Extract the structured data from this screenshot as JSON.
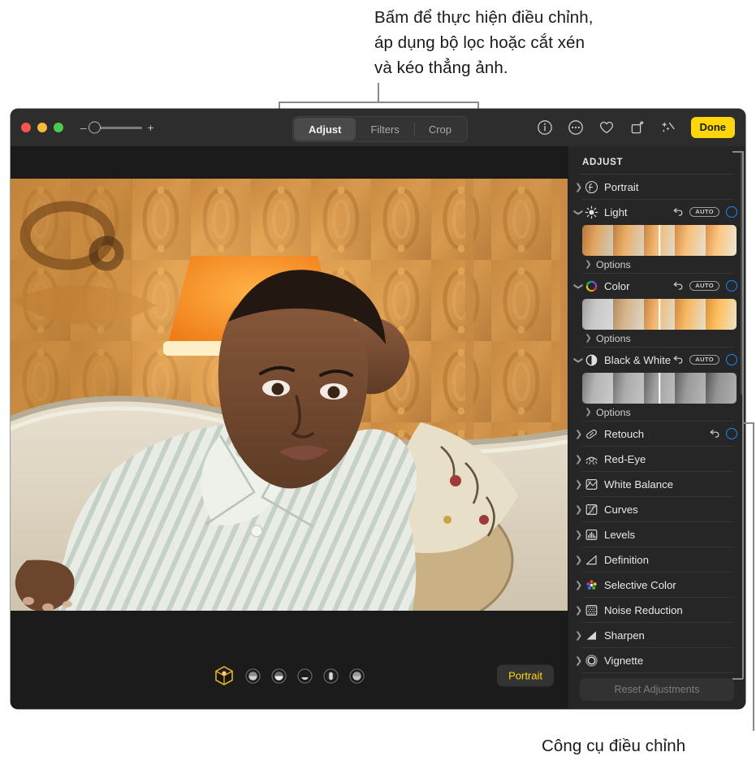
{
  "annotations": {
    "top": "Bấm để thực hiện điều chỉnh,\náp dụng bộ lọc hoặc cắt xén\nvà kéo thẳng ảnh.",
    "bottom": "Công cụ điều chỉnh"
  },
  "window": {
    "traffic_lights": [
      "close",
      "minimize",
      "zoom"
    ],
    "zoom_slider": {
      "minus": "–",
      "plus": "+",
      "value": 0
    },
    "segmented": {
      "options": [
        "Adjust",
        "Filters",
        "Crop"
      ],
      "selected": "Adjust"
    },
    "toolbar_icons": [
      "info-icon",
      "more-options-icon",
      "favorite-heart-icon",
      "rotate-icon",
      "auto-enhance-icon"
    ],
    "done_label": "Done"
  },
  "bottom_bar": {
    "lighting_effects": [
      "natural-light-cube",
      "studio-light",
      "contour-light",
      "stage-light",
      "stage-light-mono",
      "high-key-mono"
    ],
    "selected_index": 0,
    "mode_label": "Portrait"
  },
  "panel": {
    "title": "ADJUST",
    "reset_label": "Reset Adjustments",
    "options_label": "Options",
    "auto_label": "AUTO",
    "sections": [
      {
        "label": "Portrait",
        "icon": "portrait-f-icon",
        "expanded": false,
        "has_auto": false,
        "has_undo": false,
        "has_toggle": false,
        "has_filmstrip": false
      },
      {
        "label": "Light",
        "icon": "light-sun-icon",
        "expanded": true,
        "has_auto": true,
        "has_undo": true,
        "has_toggle": true,
        "has_filmstrip": true
      },
      {
        "label": "Color",
        "icon": "color-wheel-icon",
        "expanded": true,
        "has_auto": true,
        "has_undo": true,
        "has_toggle": true,
        "has_filmstrip": true
      },
      {
        "label": "Black & White",
        "icon": "black-white-circle-icon",
        "expanded": true,
        "has_auto": true,
        "has_undo": true,
        "has_toggle": true,
        "has_filmstrip": true
      },
      {
        "label": "Retouch",
        "icon": "retouch-bandage-icon",
        "expanded": false,
        "has_auto": false,
        "has_undo": true,
        "has_toggle": true,
        "has_filmstrip": false
      },
      {
        "label": "Red-Eye",
        "icon": "red-eye-icon",
        "expanded": false,
        "has_auto": false,
        "has_undo": false,
        "has_toggle": false,
        "has_filmstrip": false
      },
      {
        "label": "White Balance",
        "icon": "white-balance-icon",
        "expanded": false,
        "has_auto": false,
        "has_undo": false,
        "has_toggle": false,
        "has_filmstrip": false
      },
      {
        "label": "Curves",
        "icon": "curves-icon",
        "expanded": false,
        "has_auto": false,
        "has_undo": false,
        "has_toggle": false,
        "has_filmstrip": false
      },
      {
        "label": "Levels",
        "icon": "levels-icon",
        "expanded": false,
        "has_auto": false,
        "has_undo": false,
        "has_toggle": false,
        "has_filmstrip": false
      },
      {
        "label": "Definition",
        "icon": "definition-icon",
        "expanded": false,
        "has_auto": false,
        "has_undo": false,
        "has_toggle": false,
        "has_filmstrip": false
      },
      {
        "label": "Selective Color",
        "icon": "selective-color-icon",
        "expanded": false,
        "has_auto": false,
        "has_undo": false,
        "has_toggle": false,
        "has_filmstrip": false
      },
      {
        "label": "Noise Reduction",
        "icon": "noise-reduction-icon",
        "expanded": false,
        "has_auto": false,
        "has_undo": false,
        "has_toggle": false,
        "has_filmstrip": false
      },
      {
        "label": "Sharpen",
        "icon": "sharpen-icon",
        "expanded": false,
        "has_auto": false,
        "has_undo": false,
        "has_toggle": false,
        "has_filmstrip": false
      },
      {
        "label": "Vignette",
        "icon": "vignette-icon",
        "expanded": false,
        "has_auto": false,
        "has_undo": false,
        "has_toggle": false,
        "has_filmstrip": false
      }
    ]
  },
  "colors": {
    "accent_yellow": "#ffd60a",
    "toggle_blue": "#1b84ff",
    "panel_bg": "#262626",
    "toolbar_bg": "#2d2d2d",
    "window_bg": "#232323",
    "photo_bg": "#1b1b1b"
  }
}
